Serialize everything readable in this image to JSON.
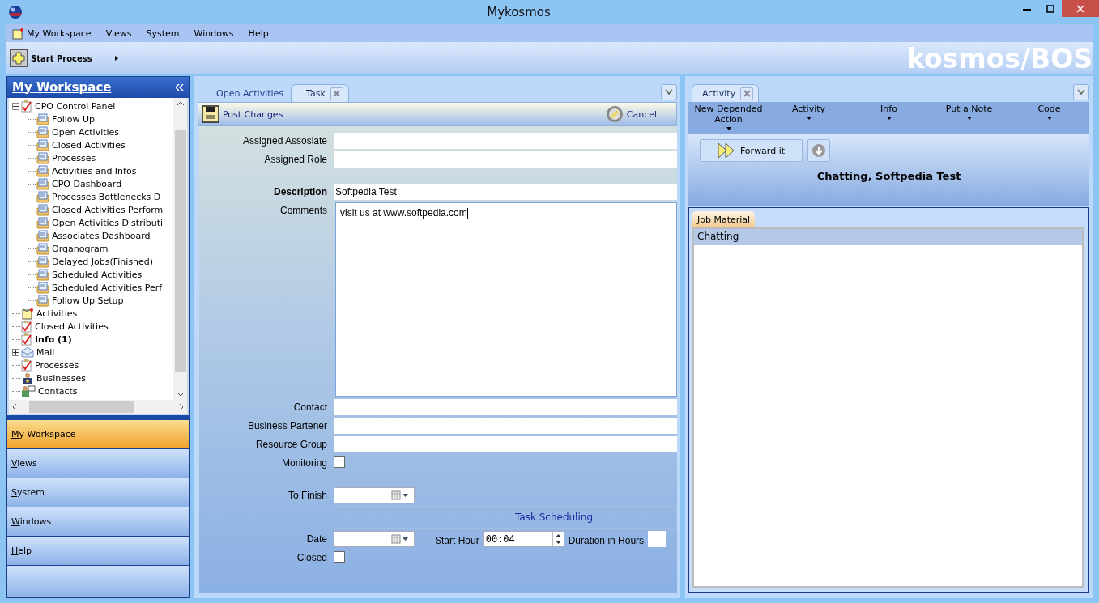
{
  "window": {
    "title": "Mykosmos"
  },
  "menu": [
    {
      "label": "My Workspace",
      "icon": true
    },
    {
      "label": "Views",
      "icon": false
    },
    {
      "label": "System",
      "icon": false
    },
    {
      "label": "Windows",
      "icon": false
    },
    {
      "label": "Help",
      "icon": false
    }
  ],
  "toolbar": {
    "button": "Start Process",
    "brand": "kosmos/BOS"
  },
  "sidebar": {
    "title": "My Workspace",
    "tree": [
      {
        "label": "CPO Control Panel",
        "kind": "check",
        "bold": false,
        "expanded": true,
        "children": [
          {
            "label": "Follow Up",
            "kind": "doc",
            "bold": false
          },
          {
            "label": "Open Activities",
            "kind": "doc",
            "bold": false
          },
          {
            "label": "Closed Activities",
            "kind": "doc",
            "bold": false
          },
          {
            "label": "Processes",
            "kind": "doc",
            "bold": false
          },
          {
            "label": "Activities and Infos",
            "kind": "doc",
            "bold": false
          },
          {
            "label": "CPO Dashboard",
            "kind": "doc",
            "bold": false
          },
          {
            "label": "Processes Bottlenecks D",
            "kind": "doc",
            "bold": false
          },
          {
            "label": "Closed Activities Perform",
            "kind": "doc",
            "bold": false
          },
          {
            "label": "Open Activities Distributi",
            "kind": "doc",
            "bold": false
          },
          {
            "label": "Associates Dashboard",
            "kind": "doc",
            "bold": false
          },
          {
            "label": "Organogram",
            "kind": "doc",
            "bold": false
          },
          {
            "label": "Delayed Jobs(Finished)",
            "kind": "doc",
            "bold": false
          },
          {
            "label": "Scheduled Activities",
            "kind": "doc",
            "bold": false
          },
          {
            "label": "Scheduled Activities Perf",
            "kind": "doc",
            "bold": false
          },
          {
            "label": "Follow Up Setup",
            "kind": "doc",
            "bold": false
          }
        ]
      },
      {
        "label": "Activities",
        "kind": "activities",
        "bold": false
      },
      {
        "label": "Closed Activities",
        "kind": "check",
        "bold": false
      },
      {
        "label": "Info (1)",
        "kind": "check",
        "bold": true
      },
      {
        "label": "Mail",
        "kind": "mail",
        "bold": false,
        "expanded": false
      },
      {
        "label": "Processes",
        "kind": "check",
        "bold": false
      },
      {
        "label": "Businesses",
        "kind": "person",
        "bold": false
      },
      {
        "label": "Contacts",
        "kind": "contact",
        "bold": false
      }
    ],
    "nav": [
      {
        "label": "My Workspace",
        "selected": true
      },
      {
        "label": "Views",
        "selected": false
      },
      {
        "label": "System",
        "selected": false
      },
      {
        "label": "Windows",
        "selected": false
      },
      {
        "label": "Help",
        "selected": false
      }
    ]
  },
  "center": {
    "tabs": [
      {
        "label": "Open Activities",
        "selected": false,
        "closable": false
      },
      {
        "label": "Task",
        "selected": true,
        "closable": true
      }
    ],
    "actions": {
      "post": "Post Changes",
      "cancel": "Cancel"
    },
    "fields": [
      {
        "kind": "text",
        "label": "Assigned Assosiate",
        "bold": false
      },
      {
        "kind": "text",
        "label": "Assigned Role",
        "bold": false
      },
      {
        "kind": "gap"
      },
      {
        "kind": "text",
        "label": "Description",
        "value": "Softpedia Test",
        "bold": true
      },
      {
        "kind": "textarea",
        "label": "Comments",
        "value": "visit us at www.softpedia.com",
        "bold": false
      },
      {
        "kind": "text",
        "label": "Contact",
        "bold": false
      },
      {
        "kind": "text",
        "label": "Business Partener",
        "bold": false
      },
      {
        "kind": "text",
        "label": "Resource Group",
        "bold": false
      },
      {
        "kind": "checkbox",
        "label": "Monitoring",
        "checked": false
      },
      {
        "kind": "gap"
      },
      {
        "kind": "date",
        "label": "To Finish"
      },
      {
        "kind": "section",
        "label": "Task Scheduling"
      },
      {
        "kind": "schedule",
        "label": "Date",
        "start_label": "Start Hour",
        "start_value": "00:04",
        "duration_label": "Duration in Hours"
      },
      {
        "kind": "checkbox",
        "label": "Closed",
        "checked": false
      }
    ]
  },
  "right": {
    "tabs": [
      {
        "label": "Activity",
        "selected": true,
        "closable": true
      }
    ],
    "menu": [
      {
        "label": "New Depended Action"
      },
      {
        "label": "Activity"
      },
      {
        "label": "Info"
      },
      {
        "label": "Put a Note"
      },
      {
        "label": "Code"
      }
    ],
    "forward": "Forward it",
    "heading": "Chatting, Softpedia Test",
    "subtabs": [
      {
        "label": "Job Material",
        "selected": true
      }
    ],
    "list_header": "Chatting"
  }
}
